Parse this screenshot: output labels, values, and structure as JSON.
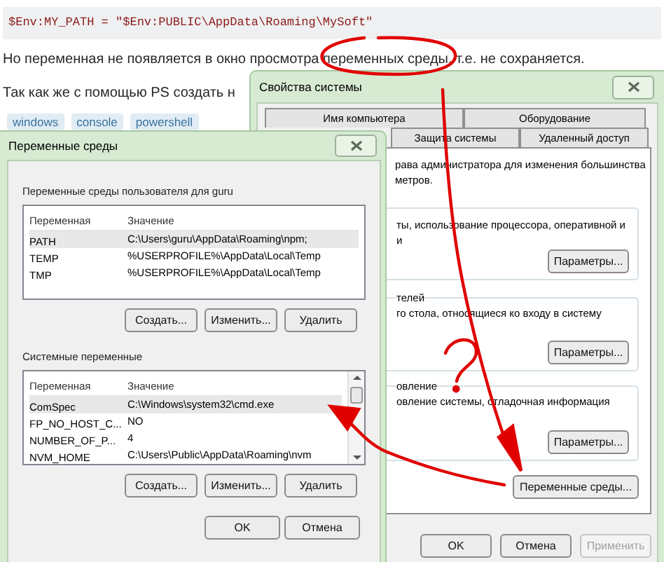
{
  "page": {
    "code": "$Env:MY_PATH = \"$Env:PUBLIC\\AppData\\Roaming\\MySoft\"",
    "paragraphs": [
      "Но переменная не появляется в окно просмотра переменных среды, т.е. не сохраняется.",
      "Так как же с помощью PS создать н"
    ],
    "tags": [
      "windows",
      "console",
      "powershell"
    ]
  },
  "system_properties": {
    "title": "Свойства системы",
    "tab_rows": [
      [
        {
          "label": "Имя компьютера",
          "selected": false
        },
        {
          "label": "Оборудование",
          "selected": false
        }
      ],
      [
        {
          "label": "Защита системы",
          "selected": false
        },
        {
          "label": "Удаленный доступ",
          "selected": false
        }
      ]
    ],
    "notice": [
      "рава администратора для изменения большинства",
      "метров."
    ],
    "groups": [
      {
        "lines": [
          "ты, использование процессора, оперативной и",
          "и"
        ],
        "button": "Параметры..."
      },
      {
        "heading": "телей",
        "lines": [
          "го стола, относящиеся ко входу в систему"
        ],
        "button": "Параметры..."
      },
      {
        "heading": "овление",
        "lines": [
          "овление системы, отладочная информация"
        ],
        "button": "Параметры..."
      }
    ],
    "env_button": "Переменные среды...",
    "buttons": [
      {
        "label": "OK",
        "disabled": false
      },
      {
        "label": "Отмена",
        "disabled": false
      },
      {
        "label": "Применить",
        "disabled": true
      }
    ]
  },
  "environment_variables": {
    "title": "Переменные среды",
    "sections": [
      {
        "label": "Переменные среды пользователя для guru",
        "columns": [
          "Переменная",
          "Значение"
        ],
        "scrollbar": false,
        "rows": [
          {
            "name": "PATH",
            "value": "C:\\Users\\guru\\AppData\\Roaming\\npm;",
            "selected": true
          },
          {
            "name": "TEMP",
            "value": "%USERPROFILE%\\AppData\\Local\\Temp",
            "selected": false
          },
          {
            "name": "TMP",
            "value": "%USERPROFILE%\\AppData\\Local\\Temp",
            "selected": false
          }
        ],
        "buttons": [
          "Создать...",
          "Изменить...",
          "Удалить"
        ]
      },
      {
        "label": "Системные переменные",
        "columns": [
          "Переменная",
          "Значение"
        ],
        "scrollbar": true,
        "rows": [
          {
            "name": "ComSpec",
            "value": "C:\\Windows\\system32\\cmd.exe",
            "selected": true
          },
          {
            "name": "FP_NO_HOST_C...",
            "value": "NO",
            "selected": false
          },
          {
            "name": "NUMBER_OF_P...",
            "value": "4",
            "selected": false
          },
          {
            "name": "NVM_HOME",
            "value": "C:\\Users\\Public\\AppData\\Roaming\\nvm",
            "selected": false
          }
        ],
        "buttons": [
          "Создать...",
          "Изменить...",
          "Удалить"
        ]
      }
    ],
    "buttons": [
      "OK",
      "Отмена"
    ]
  }
}
